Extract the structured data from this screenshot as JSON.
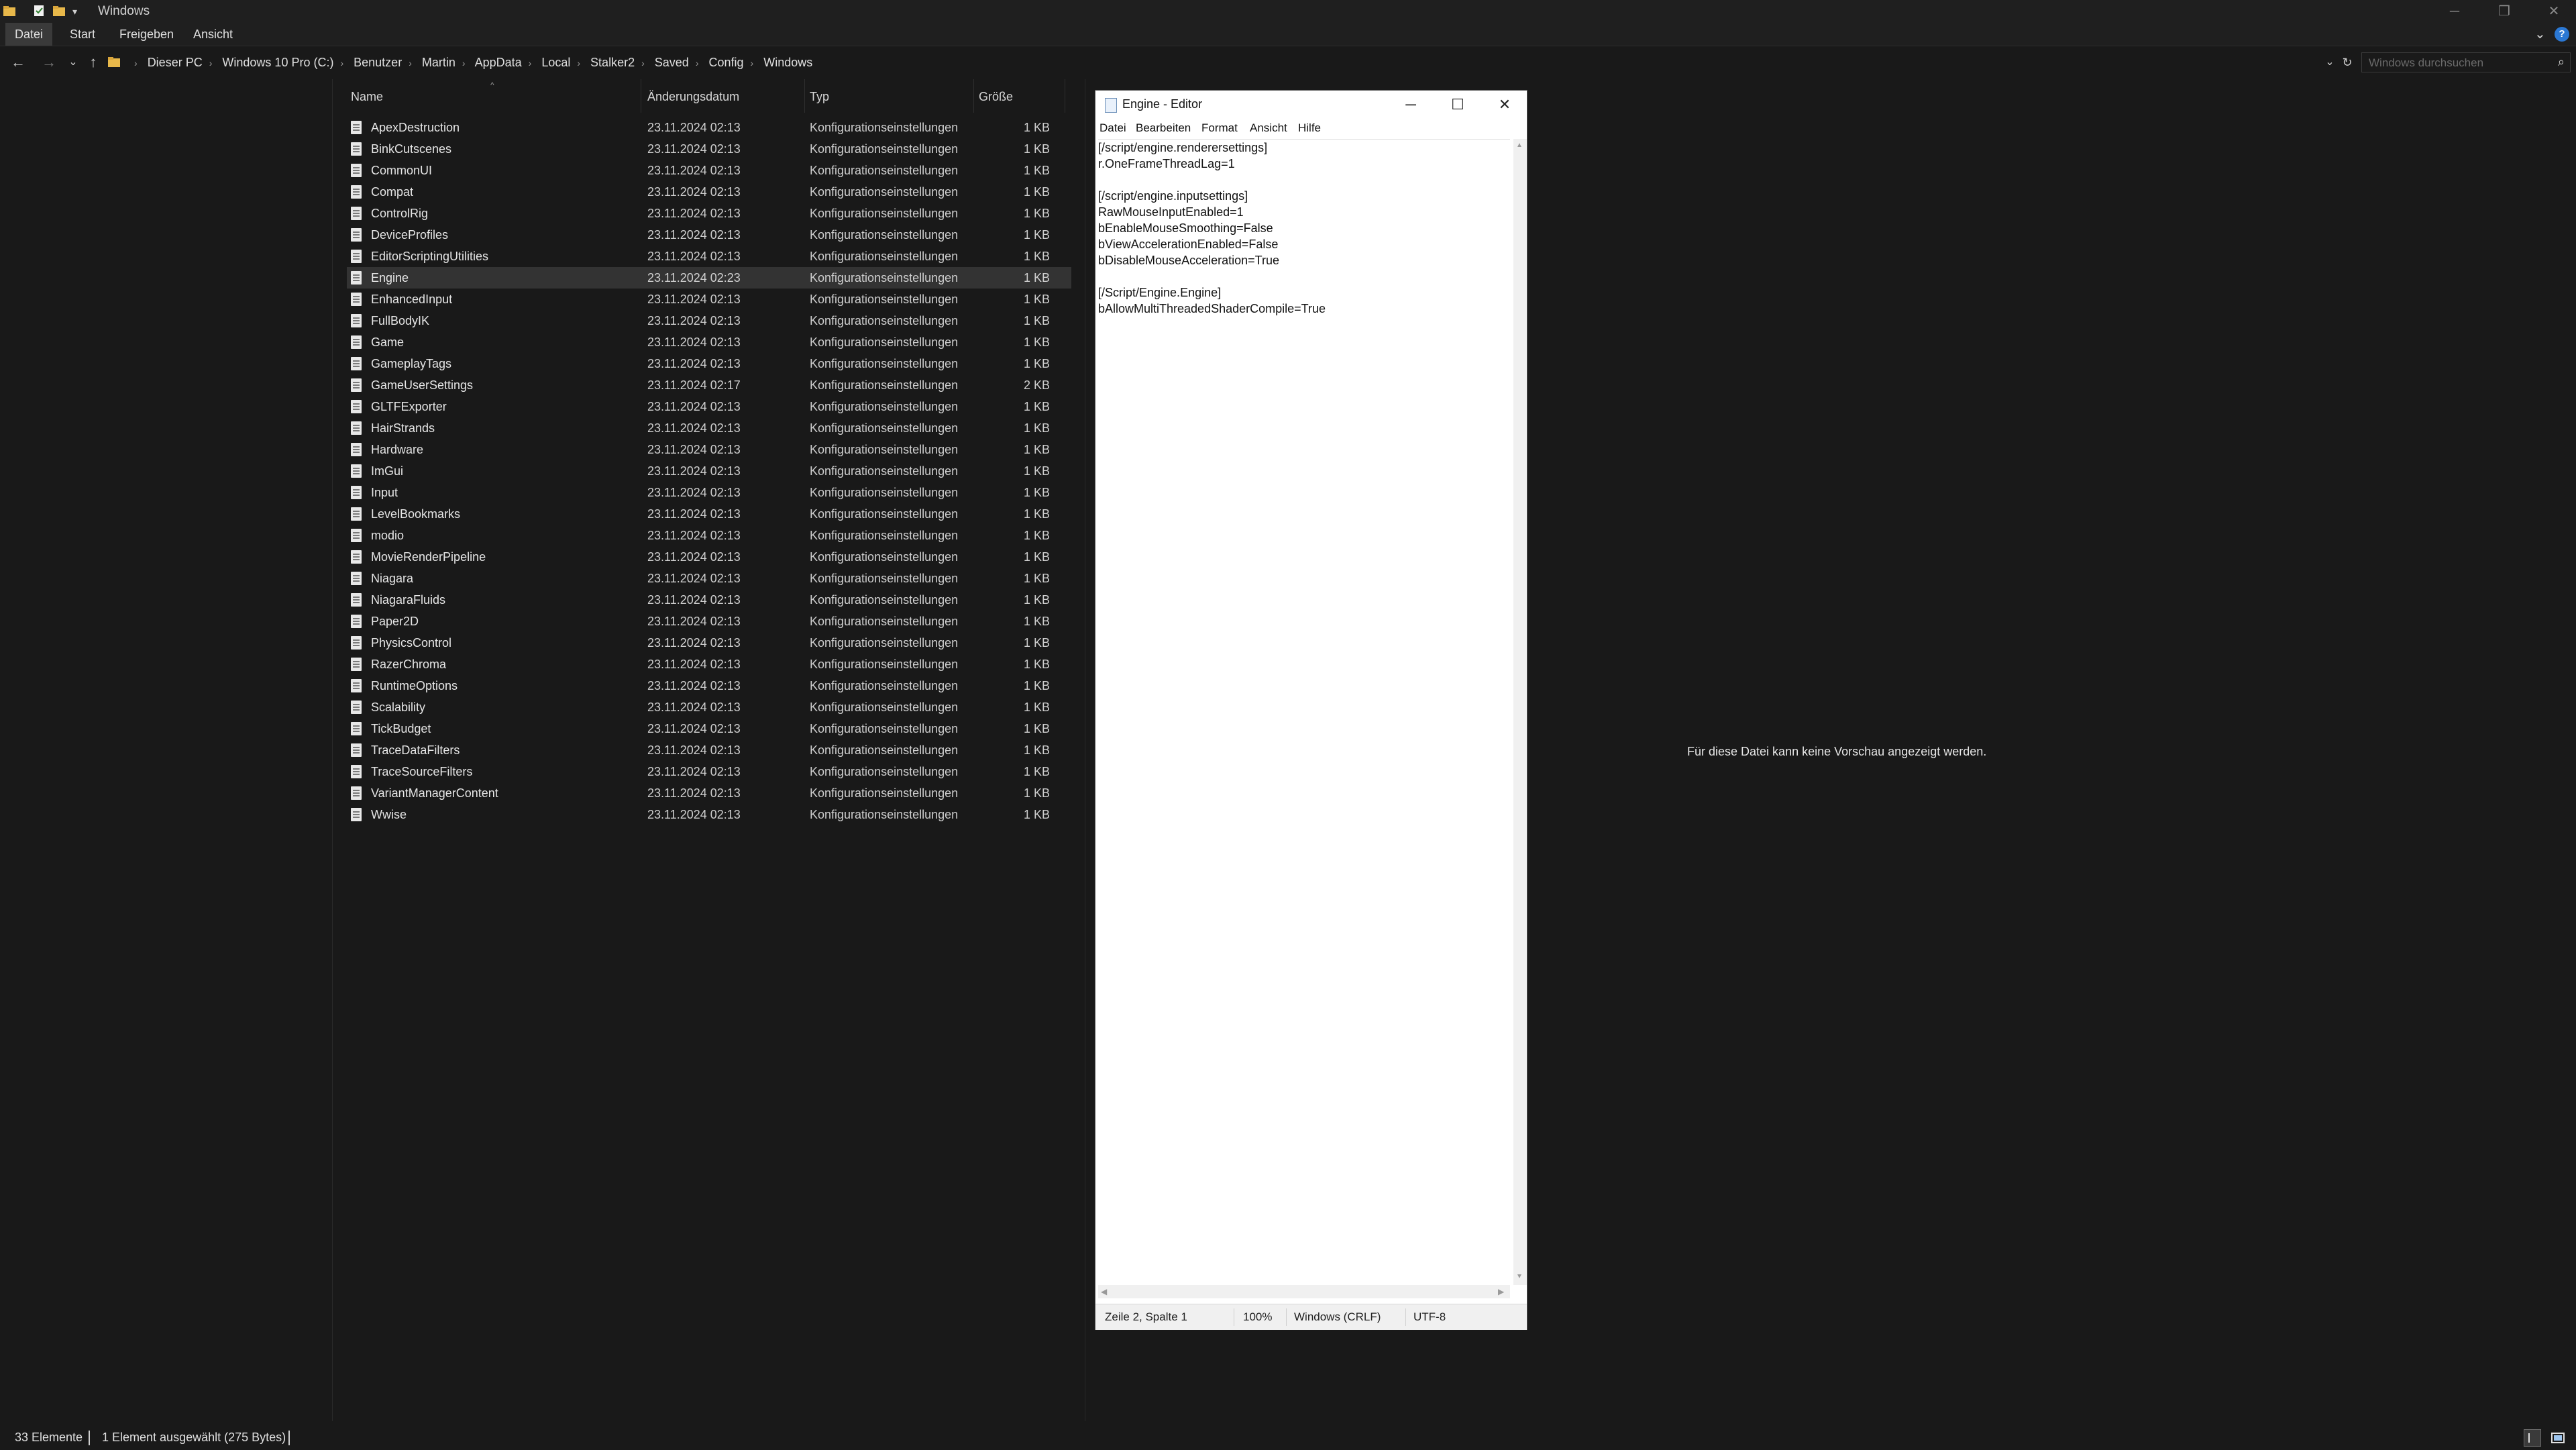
{
  "window": {
    "title": "Windows",
    "minimize": "─",
    "maximize": "❐",
    "close": "✕"
  },
  "ribbon": {
    "tabs": [
      "Datei",
      "Start",
      "Freigeben",
      "Ansicht"
    ],
    "expand_icon": "chevron-down-icon",
    "help_icon": "help-icon"
  },
  "address": {
    "path": [
      "Dieser PC",
      "Windows 10 Pro (C:)",
      "Benutzer",
      "Martin",
      "AppData",
      "Local",
      "Stalker2",
      "Saved",
      "Config",
      "Windows"
    ],
    "search_placeholder": "Windows durchsuchen"
  },
  "columns": {
    "name": "Name",
    "date": "Änderungsdatum",
    "type": "Typ",
    "size": "Größe"
  },
  "files": [
    {
      "name": "ApexDestruction",
      "date": "23.11.2024 02:13",
      "type": "Konfigurationseinstellungen",
      "size": "1 KB"
    },
    {
      "name": "BinkCutscenes",
      "date": "23.11.2024 02:13",
      "type": "Konfigurationseinstellungen",
      "size": "1 KB"
    },
    {
      "name": "CommonUI",
      "date": "23.11.2024 02:13",
      "type": "Konfigurationseinstellungen",
      "size": "1 KB"
    },
    {
      "name": "Compat",
      "date": "23.11.2024 02:13",
      "type": "Konfigurationseinstellungen",
      "size": "1 KB"
    },
    {
      "name": "ControlRig",
      "date": "23.11.2024 02:13",
      "type": "Konfigurationseinstellungen",
      "size": "1 KB"
    },
    {
      "name": "DeviceProfiles",
      "date": "23.11.2024 02:13",
      "type": "Konfigurationseinstellungen",
      "size": "1 KB"
    },
    {
      "name": "EditorScriptingUtilities",
      "date": "23.11.2024 02:13",
      "type": "Konfigurationseinstellungen",
      "size": "1 KB"
    },
    {
      "name": "Engine",
      "date": "23.11.2024 02:23",
      "type": "Konfigurationseinstellungen",
      "size": "1 KB"
    },
    {
      "name": "EnhancedInput",
      "date": "23.11.2024 02:13",
      "type": "Konfigurationseinstellungen",
      "size": "1 KB"
    },
    {
      "name": "FullBodyIK",
      "date": "23.11.2024 02:13",
      "type": "Konfigurationseinstellungen",
      "size": "1 KB"
    },
    {
      "name": "Game",
      "date": "23.11.2024 02:13",
      "type": "Konfigurationseinstellungen",
      "size": "1 KB"
    },
    {
      "name": "GameplayTags",
      "date": "23.11.2024 02:13",
      "type": "Konfigurationseinstellungen",
      "size": "1 KB"
    },
    {
      "name": "GameUserSettings",
      "date": "23.11.2024 02:17",
      "type": "Konfigurationseinstellungen",
      "size": "2 KB"
    },
    {
      "name": "GLTFExporter",
      "date": "23.11.2024 02:13",
      "type": "Konfigurationseinstellungen",
      "size": "1 KB"
    },
    {
      "name": "HairStrands",
      "date": "23.11.2024 02:13",
      "type": "Konfigurationseinstellungen",
      "size": "1 KB"
    },
    {
      "name": "Hardware",
      "date": "23.11.2024 02:13",
      "type": "Konfigurationseinstellungen",
      "size": "1 KB"
    },
    {
      "name": "ImGui",
      "date": "23.11.2024 02:13",
      "type": "Konfigurationseinstellungen",
      "size": "1 KB"
    },
    {
      "name": "Input",
      "date": "23.11.2024 02:13",
      "type": "Konfigurationseinstellungen",
      "size": "1 KB"
    },
    {
      "name": "LevelBookmarks",
      "date": "23.11.2024 02:13",
      "type": "Konfigurationseinstellungen",
      "size": "1 KB"
    },
    {
      "name": "modio",
      "date": "23.11.2024 02:13",
      "type": "Konfigurationseinstellungen",
      "size": "1 KB"
    },
    {
      "name": "MovieRenderPipeline",
      "date": "23.11.2024 02:13",
      "type": "Konfigurationseinstellungen",
      "size": "1 KB"
    },
    {
      "name": "Niagara",
      "date": "23.11.2024 02:13",
      "type": "Konfigurationseinstellungen",
      "size": "1 KB"
    },
    {
      "name": "NiagaraFluids",
      "date": "23.11.2024 02:13",
      "type": "Konfigurationseinstellungen",
      "size": "1 KB"
    },
    {
      "name": "Paper2D",
      "date": "23.11.2024 02:13",
      "type": "Konfigurationseinstellungen",
      "size": "1 KB"
    },
    {
      "name": "PhysicsControl",
      "date": "23.11.2024 02:13",
      "type": "Konfigurationseinstellungen",
      "size": "1 KB"
    },
    {
      "name": "RazerChroma",
      "date": "23.11.2024 02:13",
      "type": "Konfigurationseinstellungen",
      "size": "1 KB"
    },
    {
      "name": "RuntimeOptions",
      "date": "23.11.2024 02:13",
      "type": "Konfigurationseinstellungen",
      "size": "1 KB"
    },
    {
      "name": "Scalability",
      "date": "23.11.2024 02:13",
      "type": "Konfigurationseinstellungen",
      "size": "1 KB"
    },
    {
      "name": "TickBudget",
      "date": "23.11.2024 02:13",
      "type": "Konfigurationseinstellungen",
      "size": "1 KB"
    },
    {
      "name": "TraceDataFilters",
      "date": "23.11.2024 02:13",
      "type": "Konfigurationseinstellungen",
      "size": "1 KB"
    },
    {
      "name": "TraceSourceFilters",
      "date": "23.11.2024 02:13",
      "type": "Konfigurationseinstellungen",
      "size": "1 KB"
    },
    {
      "name": "VariantManagerContent",
      "date": "23.11.2024 02:13",
      "type": "Konfigurationseinstellungen",
      "size": "1 KB"
    },
    {
      "name": "Wwise",
      "date": "23.11.2024 02:13",
      "type": "Konfigurationseinstellungen",
      "size": "1 KB"
    }
  ],
  "selected_file": "Engine",
  "preview": {
    "message": "Für diese Datei kann keine Vorschau angezeigt werden."
  },
  "editor": {
    "title": "Engine - Editor",
    "menu": [
      "Datei",
      "Bearbeiten",
      "Format",
      "Ansicht",
      "Hilfe"
    ],
    "lines": [
      "[/script/engine.renderersettings]",
      "r.OneFrameThreadLag=1",
      "",
      "[/script/engine.inputsettings]",
      "RawMouseInputEnabled=1",
      "bEnableMouseSmoothing=False",
      "bViewAccelerationEnabled=False",
      "bDisableMouseAcceleration=True",
      "",
      "[/Script/Engine.Engine]",
      "bAllowMultiThreadedShaderCompile=True"
    ],
    "status": {
      "position": "Zeile 2, Spalte 1",
      "zoom": "100%",
      "line_ending": "Windows (CRLF)",
      "encoding": "UTF-8"
    }
  },
  "statusbar": {
    "count": "33 Elemente",
    "selection": "1 Element ausgewählt (275 Bytes)"
  },
  "colors": {
    "background": "#191919",
    "selected_row": "#333333",
    "accent": "#0078d7"
  }
}
